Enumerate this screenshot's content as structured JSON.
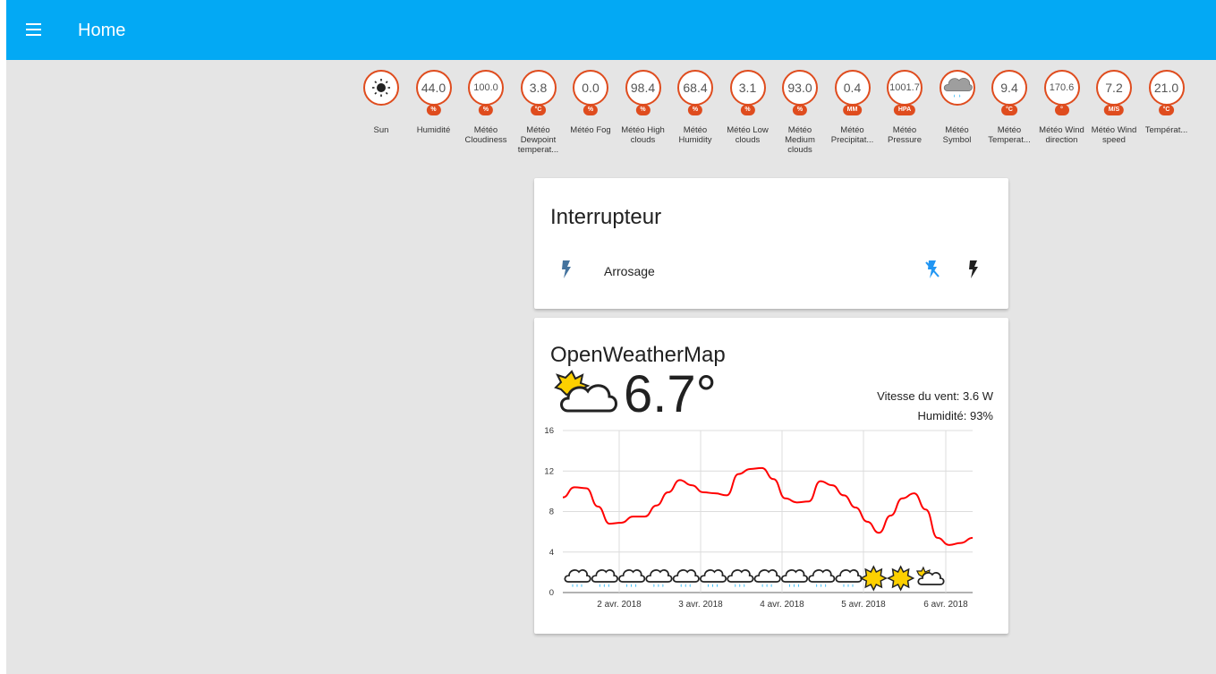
{
  "app": {
    "title": "Home"
  },
  "colors": {
    "toolbar": "#03a9f4",
    "badge_accent": "#df4c1e",
    "chart_line": "#ff0000",
    "switch_on": "#2196f3",
    "switch_off": "#212121"
  },
  "badges": [
    {
      "value": "",
      "unit": "",
      "label": "Sun",
      "icon": "sun-icon"
    },
    {
      "value": "44.0",
      "unit": "%",
      "label": "Humidité"
    },
    {
      "value": "100.0",
      "unit": "%",
      "label": "Météo Cloudiness"
    },
    {
      "value": "3.8",
      "unit": "°C",
      "label": "Météo Dewpoint temperat..."
    },
    {
      "value": "0.0",
      "unit": "%",
      "label": "Météo Fog"
    },
    {
      "value": "98.4",
      "unit": "%",
      "label": "Météo High clouds"
    },
    {
      "value": "68.4",
      "unit": "%",
      "label": "Météo Humidity"
    },
    {
      "value": "3.1",
      "unit": "%",
      "label": "Météo Low clouds"
    },
    {
      "value": "93.0",
      "unit": "%",
      "label": "Météo Medium clouds"
    },
    {
      "value": "0.4",
      "unit": "MM",
      "label": "Météo Precipitat..."
    },
    {
      "value": "1001.7",
      "unit": "HPA",
      "label": "Météo Pressure"
    },
    {
      "value": "",
      "unit": "",
      "label": "Météo Symbol",
      "icon": "rain-cloud-icon"
    },
    {
      "value": "9.4",
      "unit": "°C",
      "label": "Météo Temperat..."
    },
    {
      "value": "170.6",
      "unit": "°",
      "label": "Météo Wind direction"
    },
    {
      "value": "7.2",
      "unit": "M/S",
      "label": "Météo Wind speed"
    },
    {
      "value": "21.0",
      "unit": "°C",
      "label": "Températ..."
    }
  ],
  "switch_card": {
    "title": "Interrupteur",
    "entity_label": "Arrosage",
    "entity_icon": "flash-icon",
    "off_button_icon": "flash-off-icon",
    "on_button_icon": "flash-icon"
  },
  "weather_card": {
    "title": "OpenWeatherMap",
    "temperature": "6.7°",
    "condition_icon": "partly-cloudy-icon",
    "wind": "Vitesse du vent: 3.6 W",
    "humidity": "Humidité: 93%"
  },
  "chart_data": {
    "type": "line",
    "y_ticks": [
      "16",
      "12",
      "8",
      "4",
      "0"
    ],
    "ylim": [
      0,
      16
    ],
    "x_labels": [
      "2 avr. 2018",
      "3 avr. 2018",
      "4 avr. 2018",
      "5 avr. 2018",
      "6 avr. 2018"
    ],
    "series": [
      {
        "values": [
          9.4,
          10.4,
          10.3,
          8.5,
          6.8,
          6.9,
          7.5,
          7.5,
          8.6,
          9.9,
          11.1,
          10.6,
          9.9,
          9.8,
          9.6,
          11.7,
          12.2,
          12.3,
          11.2,
          9.3,
          8.9,
          9.0,
          11.0,
          10.6,
          9.6,
          8.4,
          7.0,
          5.9,
          7.6,
          9.3,
          9.8,
          8.2,
          5.4,
          4.7,
          4.9,
          5.4
        ]
      }
    ],
    "forecast_icons": [
      "rain-cloud-icon",
      "rain-cloud-icon",
      "rain-cloud-icon",
      "rain-cloud-icon",
      "rain-cloud-icon",
      "rain-cloud-icon",
      "rain-cloud-icon",
      "rain-cloud-icon",
      "rain-cloud-icon",
      "rain-cloud-icon",
      "rain-cloud-icon",
      "sun-icon",
      "sun-icon",
      "partly-cloudy-icon"
    ],
    "grid": true
  }
}
